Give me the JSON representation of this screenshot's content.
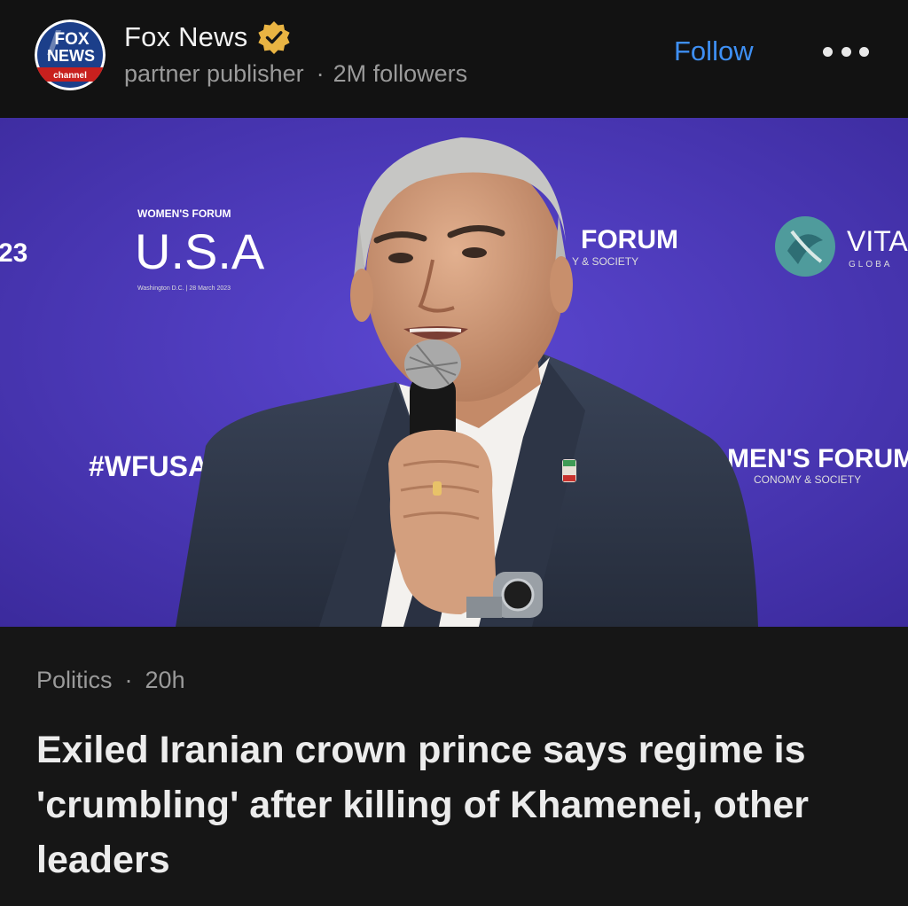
{
  "publisher": {
    "name": "Fox News",
    "role": "partner publisher",
    "followers": "2M followers",
    "verified": true,
    "logo": {
      "line1": "FOX",
      "line2": "NEWS",
      "line3": "channel"
    }
  },
  "actions": {
    "follow_label": "Follow",
    "more_icon": "more-horizontal-icon"
  },
  "article": {
    "category": "Politics",
    "age": "20h",
    "headline": "Exiled Iranian crown prince says regime is 'crumbling' after killing of Khamenei, other leaders"
  },
  "photo_backdrop": {
    "left_fragment": "23",
    "brand_small": "WOMEN'S FORUM",
    "brand_big": "U.S.A",
    "brand_dateline": "Washington D.C. | 28 March 2023",
    "hashtag": "#WFUSA",
    "forum_top": "FORUM",
    "forum_top_sub": "Y & SOCIETY",
    "partner": "VITA",
    "partner_sub": "GLOBA",
    "forum_bottom": "MEN'S FORUM",
    "forum_bottom_sub": "CONOMY & SOCIETY"
  },
  "colors": {
    "header_bg": "#121212",
    "page_bg": "#161616",
    "link_blue": "#3e8ff3",
    "backdrop_purple": "#4a35b8",
    "badge_gold": "#e9b443"
  }
}
